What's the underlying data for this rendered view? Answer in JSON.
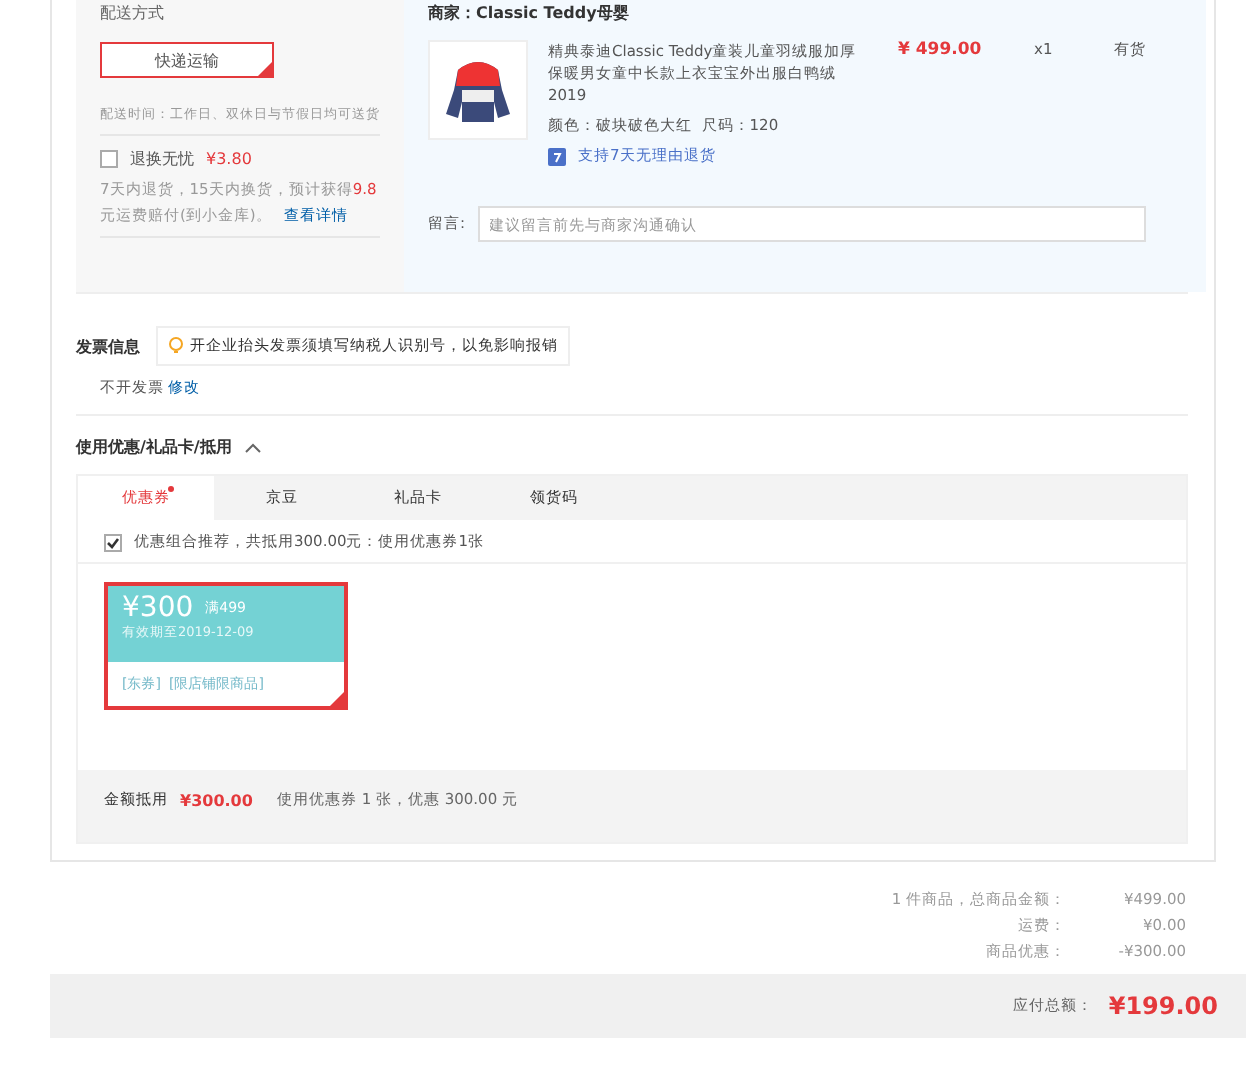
{
  "shipping": {
    "label": "配送方式",
    "method": "快递运输",
    "selected": true,
    "time_label": "配送时间：",
    "time_value": "工作日、双休日与节假日均可送货",
    "insurance": {
      "label": "退换无忧",
      "price": "¥3.80",
      "checked": false,
      "note": "7天内退货，15天内换货，预计获得**9.8**元运费赔付(到小金库)。",
      "link": "查看详情"
    }
  },
  "order": {
    "seller": "商家：Classic Teddy母婴",
    "product": {
      "title": "精典泰迪Classic Teddy童装儿童羽绒服加厚保暖男女童中长款上衣宝宝外出服白鸭绒2019",
      "price": "¥ 499.00",
      "qty": "x1",
      "stock": "有货",
      "color_label": "颜色：",
      "variant": "破块破色大红",
      "size_label": "尺码：",
      "size": "120",
      "service": "支持7天无理由退货"
    },
    "note_label": "留言:",
    "note_placeholder": "建议留言前先与商家沟通确认"
  },
  "invoice": {
    "title": "发票信息",
    "tip": "开企业抬头发票须填写纳税人识别号，以免影响报销",
    "value": "不开发票",
    "edit": "修改"
  },
  "discount": {
    "title": "使用优惠/礼品卡/抵用",
    "expanded": true,
    "tabs": [
      {
        "label": "优惠券",
        "selected": true,
        "dot": true
      },
      {
        "label": "京豆",
        "selected": false,
        "dot": false
      },
      {
        "label": "礼品卡",
        "selected": false,
        "dot": false
      },
      {
        "label": "领货码",
        "selected": false,
        "dot": false
      }
    ],
    "combo": {
      "checked": true,
      "text": "优惠组合推荐，共抵用300.00元：使用优惠券1张"
    },
    "coupons": [
      {
        "amount": "¥300",
        "condition": "满499",
        "expiry": "有效期至2019-12-09",
        "tags": [
          "[东券]",
          "[限店铺限商品]"
        ],
        "selected": true
      }
    ],
    "total_label": "金额抵用",
    "total": "¥300.00",
    "summary": "使用优惠券 1 张，优惠 300.00 元"
  },
  "totals": {
    "rows": [
      {
        "label": "1 件商品，总商品金额：",
        "value": "¥499.00"
      },
      {
        "label": "运费：",
        "value": "¥0.00"
      },
      {
        "label": "商品优惠：",
        "value": "-¥300.00"
      }
    ],
    "due_label": "应付总额：",
    "due": "¥199.00"
  }
}
